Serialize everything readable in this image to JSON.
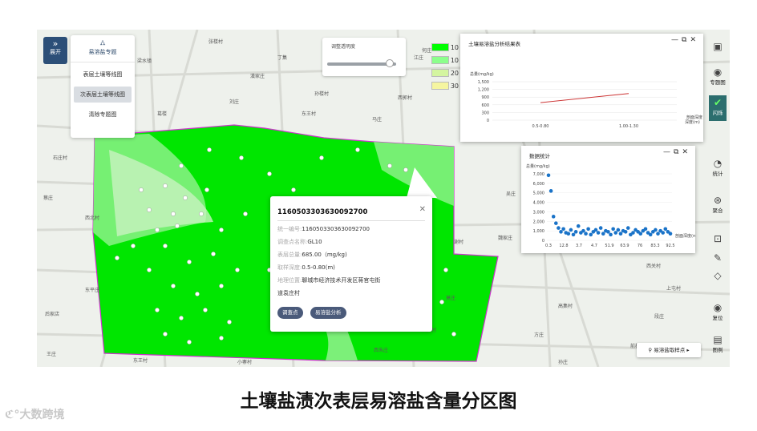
{
  "map": {
    "labels": [
      "张楼村",
      "弧庄",
      "梁水镇",
      "尚村",
      "漢家庄",
      "孙楼村",
      "乔新街",
      "刘庄",
      "前大王庄",
      "马庄",
      "西郭村",
      "东王村",
      "何庄",
      "石庄村",
      "蔡庄",
      "西北村",
      "吴庄",
      "魏家庄",
      "莫庄",
      "上屯村",
      "段庄",
      "高集村",
      "方庄",
      "后家店",
      "王庄",
      "北大营",
      "东王村",
      "赵家村",
      "孙庄",
      "前杨庄",
      "西朱庄",
      "葛楼",
      "丁集",
      "江庄",
      "丁庄",
      "阎寺",
      "张村",
      "西关村",
      "官庄村",
      "小寨村",
      "东大营村",
      "大张村",
      "东平庄",
      "谢村"
    ],
    "colors": {
      "high": "#00e600",
      "mid": "#7cf079",
      "low": "#e8f6a6",
      "edge": "#cc33cc"
    }
  },
  "expand": {
    "icon": "double-chevron-icon",
    "label": "展开"
  },
  "topic_panel": {
    "title": "易溶盐专题",
    "items": [
      "表层土壤等线图",
      "次表层土壤等线图",
      "清除专题图"
    ]
  },
  "opacity": {
    "label": "调整透明度",
    "value": 0.85
  },
  "legend": [
    {
      "color": "#00ff00",
      "label": "10"
    },
    {
      "color": "#8cff8c",
      "label": "10"
    },
    {
      "color": "#d4f5a0",
      "label": "20"
    },
    {
      "color": "#f5f5a0",
      "label": "30"
    }
  ],
  "line_chart": {
    "title": "土壤易溶盐分析结果表",
    "ylabel": "总量(mg/kg)",
    "xlabel": "剖面深度",
    "chart_data": {
      "type": "line",
      "categories": [
        "0.5-0.80",
        "1.00-1.30"
      ],
      "values": [
        685,
        1040
      ],
      "yticks": [
        "1,500",
        "1,200",
        "900",
        "600",
        "300",
        "0"
      ],
      "ylim": [
        0,
        1500
      ],
      "color": "#cc3333",
      "xunit": "深度(m)"
    }
  },
  "scatter_chart": {
    "title": "数据统计",
    "ylabel": "总量(mg/kg)",
    "xlabel": "剖面深度(m)",
    "chart_data": {
      "type": "scatter",
      "xticks": [
        "0.3",
        "12.8",
        "3.7",
        "4.7",
        "51.9",
        "63.9",
        "76",
        "83.3",
        "92.5"
      ],
      "yticks": [
        "7,000",
        "6,000",
        "5,000",
        "4,000",
        "3,000",
        "2,000",
        "1,000",
        "0"
      ],
      "ylim": [
        0,
        7000
      ],
      "color": "#1a73c8",
      "values": [
        6850,
        5200,
        2500,
        1800,
        1300,
        900,
        1200,
        800,
        700,
        1100,
        600,
        900,
        1500,
        800,
        1000,
        700,
        1200,
        600,
        900,
        1100,
        800,
        1300,
        700,
        1000,
        900,
        600,
        1200,
        800,
        1100,
        700,
        1000,
        900,
        1300,
        600,
        800,
        1100,
        900,
        700,
        1000,
        1200,
        800,
        600,
        900,
        1100,
        700,
        1000,
        800,
        1200,
        900,
        700
      ]
    }
  },
  "popup": {
    "id": "1160503303630092700",
    "rows": [
      {
        "k": "统一编号:",
        "v": "1160503303630092700"
      },
      {
        "k": "调查点名称:",
        "v": "GL10"
      },
      {
        "k": "表层总量:",
        "v": "685.00（mg/kg)"
      },
      {
        "k": "取样深度:",
        "v": "0.5-0.80(m)"
      },
      {
        "k": "地理位置:",
        "v": "聊城市经济技术开发区蒋官屯街"
      }
    ],
    "row_extra": "道袁庄村",
    "buttons": [
      "调查点",
      "易溶盐分析"
    ]
  },
  "right_tools": [
    {
      "icon": "layers-icon",
      "label": ""
    },
    {
      "icon": "globe-icon",
      "label": "专题图"
    },
    {
      "icon": "check-icon",
      "label": "闪烁"
    },
    {
      "icon": "pie-icon",
      "label": "统计"
    },
    {
      "icon": "aggregate-icon",
      "label": "聚合"
    },
    {
      "icon": "measure-icon",
      "label": ""
    },
    {
      "icon": "ruler-icon",
      "label": ""
    },
    {
      "icon": "eraser-icon",
      "label": ""
    },
    {
      "icon": "globe-icon",
      "label": "复位"
    },
    {
      "icon": "legend-icon",
      "label": "图例"
    }
  ],
  "sample_tag": {
    "icon": "pin-icon",
    "label": "易溶盐取样点"
  },
  "caption": "土壤盐渍次表层易溶盐含量分区图",
  "logo": "大数跨境"
}
